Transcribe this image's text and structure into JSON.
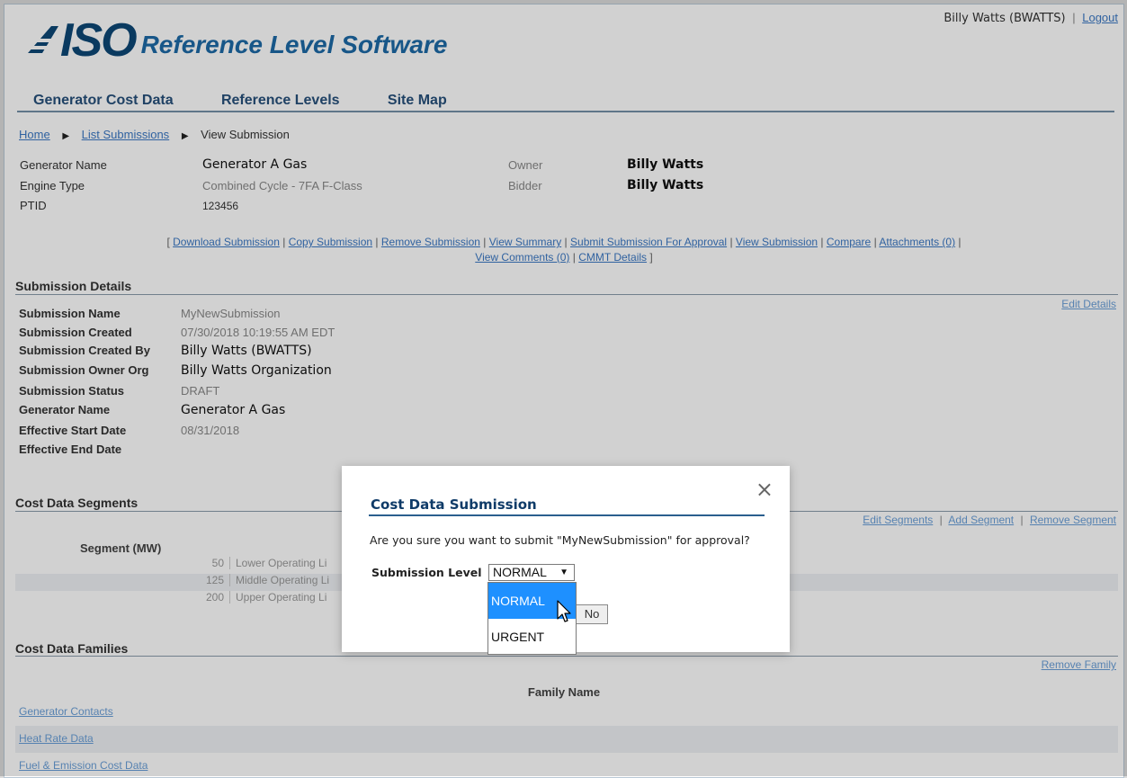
{
  "header": {
    "logo_text": "ISO",
    "app_title": "Reference Level Software",
    "user_name": "Billy Watts (BWATTS)",
    "user_sep": "|",
    "logout_label": "Logout"
  },
  "nav": {
    "items": [
      "Generator Cost Data",
      "Reference Levels",
      "Site Map"
    ]
  },
  "breadcrumb": {
    "home": "Home",
    "list": "List Submissions",
    "current": "View Submission"
  },
  "generator_info": {
    "generator_name_label": "Generator Name",
    "generator_name": "Generator A Gas",
    "engine_type_label": "Engine Type",
    "engine_type": "Combined Cycle - 7FA F-Class",
    "ptid_label": "PTID",
    "ptid": "123456",
    "owner_label": "Owner",
    "owner": "Billy Watts",
    "bidder_label": "Bidder",
    "bidder": "Billy Watts"
  },
  "actions": {
    "open": "[",
    "close": "]",
    "sep": "|",
    "items": [
      "Download Submission",
      "Copy Submission",
      "Remove Submission",
      "View Summary",
      "Submit Submission For Approval",
      "View Submission",
      "Compare",
      "Attachments (0)",
      "View Comments (0)",
      "CMMT Details"
    ]
  },
  "submission_details": {
    "title": "Submission Details",
    "edit_label": "Edit Details",
    "rows": [
      {
        "k": "Submission Name",
        "v": "MyNewSubmission"
      },
      {
        "k": "Submission Created",
        "v": "07/30/2018 10:19:55 AM EDT"
      },
      {
        "k": "Submission Created By",
        "v": "Billy Watts (BWATTS)"
      },
      {
        "k": "Submission Owner Org",
        "v": "Billy Watts Organization"
      },
      {
        "k": "Submission Status",
        "v": "DRAFT"
      },
      {
        "k": "Generator Name",
        "v": "Generator A Gas"
      },
      {
        "k": "Effective Start Date",
        "v": "08/31/2018"
      },
      {
        "k": "Effective End Date",
        "v": ""
      }
    ]
  },
  "cost_segments": {
    "title": "Cost Data Segments",
    "edit_segments": "Edit Segments",
    "add_segment": "Add Segment",
    "remove_segment": "Remove Segment",
    "sep": "|",
    "column_header": "Segment (MW)",
    "rows": [
      {
        "mw": "50",
        "name": "Lower Operating Li"
      },
      {
        "mw": "125",
        "name": "Middle Operating Li"
      },
      {
        "mw": "200",
        "name": "Upper Operating Li"
      }
    ]
  },
  "cost_families": {
    "title": "Cost Data Families",
    "remove_family": "Remove Family",
    "column_header": "Family Name",
    "rows": [
      "Generator Contacts",
      "Heat Rate Data",
      "Fuel & Emission Cost Data"
    ]
  },
  "modal": {
    "close_glyph": "×",
    "title": "Cost Data Submission",
    "message": "Are you sure you want to submit \"MyNewSubmission\" for approval?",
    "level_label": "Submission Level",
    "selected_value": "NORMAL",
    "caret": "▼",
    "options": [
      "NORMAL",
      "URGENT"
    ],
    "no_label": "No"
  }
}
